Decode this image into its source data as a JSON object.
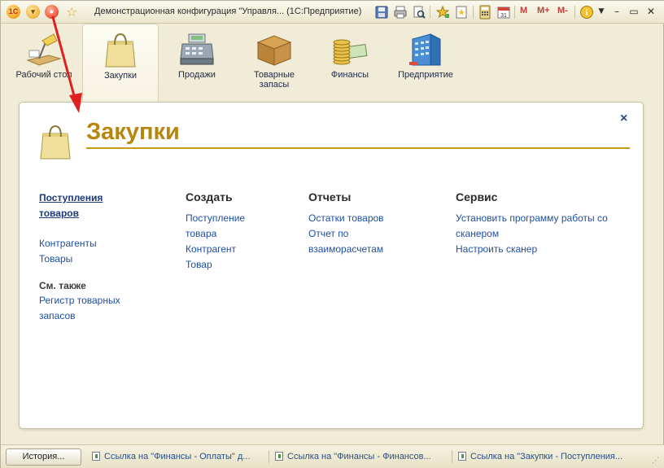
{
  "window": {
    "title": "Демонстрационная конфигурация \"Управля... (1С:Предприятие)",
    "logo_text": "1С",
    "toolbar": {
      "m_label": "M",
      "mplus_label": "M+",
      "mminus_label": "M-",
      "info_label": "i"
    }
  },
  "sections": [
    {
      "label": "Рабочий стол",
      "icon": "desk-lamp-icon",
      "active": false
    },
    {
      "label": "Закупки",
      "icon": "shopping-bag-icon",
      "active": true
    },
    {
      "label": "Продажи",
      "icon": "cash-register-icon",
      "active": false
    },
    {
      "label": "Товарные запасы",
      "icon": "box-icon",
      "active": false
    },
    {
      "label": "Финансы",
      "icon": "coins-icon",
      "active": false
    },
    {
      "label": "Предприятие",
      "icon": "building-icon",
      "active": false
    }
  ],
  "content": {
    "title": "Закупки",
    "close_label": "×",
    "nav": {
      "primary": "Поступления товаров",
      "items": [
        "Контрагенты",
        "Товары"
      ],
      "see_also_header": "См. также",
      "see_also_items": [
        "Регистр товарных запасов"
      ]
    },
    "create": {
      "header": "Создать",
      "items": [
        "Поступление товара",
        "Контрагент",
        "Товар"
      ]
    },
    "reports": {
      "header": "Отчеты",
      "items": [
        "Остатки товаров",
        "Отчет по взаиморасчетам"
      ]
    },
    "service": {
      "header": "Сервис",
      "items": [
        "Установить программу работы со сканером",
        "Настроить сканер"
      ]
    }
  },
  "statusbar": {
    "history_label": "История...",
    "history_items": [
      "Ссылка на \"Финансы - Оплаты\" д...",
      "Ссылка на \"Финансы - Финансов...",
      "Ссылка на \"Закупки - Поступления..."
    ]
  },
  "colors": {
    "accent_title": "#b8860b",
    "link": "#1f4fa2",
    "arrow": "#e02020"
  }
}
